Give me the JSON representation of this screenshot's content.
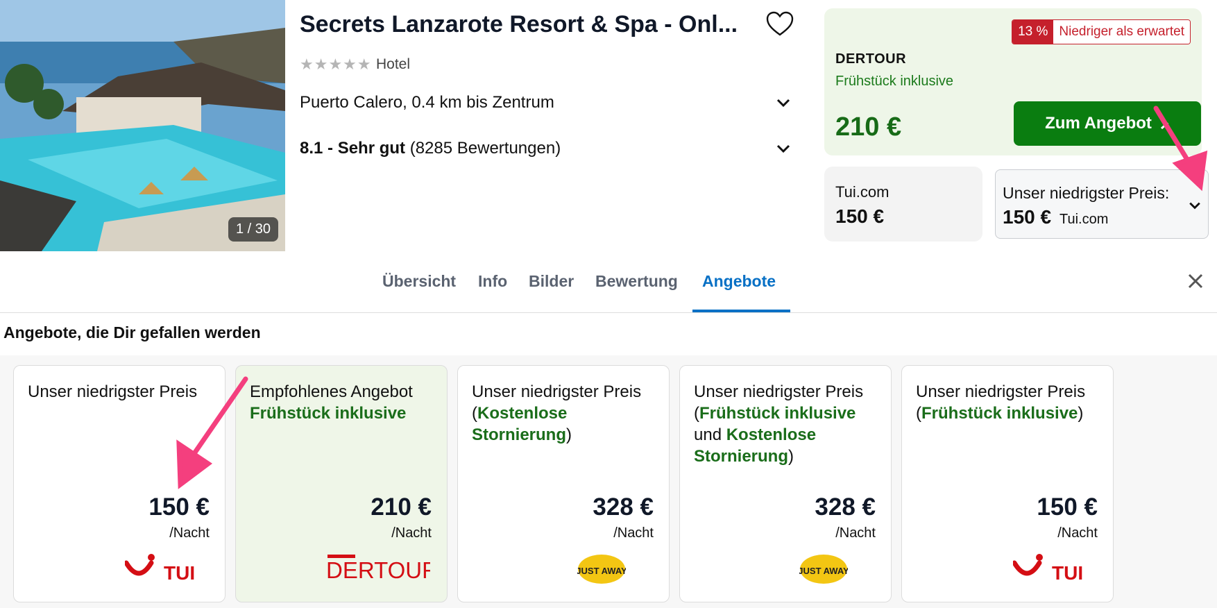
{
  "hotel": {
    "title": "Secrets Lanzarote Resort & Spa - Onl...",
    "stars": "★★★★★",
    "type": "Hotel",
    "location": "Puerto Calero, 0.4 km bis Zentrum",
    "rating_score": "8.1 - Sehr gut",
    "rating_count": "(8285 Bewertungen)",
    "image_counter": "1 / 30"
  },
  "offer": {
    "badge_pct": "13 %",
    "badge_text": "Niedriger als erwartet",
    "provider": "DERTOUR",
    "board": "Frühstück inklusive",
    "price": "210 €",
    "cta": "Zum Angebot"
  },
  "alt_offer": {
    "provider": "Tui.com",
    "price": "150 €"
  },
  "lowest": {
    "label": "Unser niedrigster Preis:",
    "price": "150 €",
    "provider": "Tui.com"
  },
  "tabs": [
    {
      "label": "Übersicht"
    },
    {
      "label": "Info"
    },
    {
      "label": "Bilder"
    },
    {
      "label": "Bewertung"
    },
    {
      "label": "Angebote"
    }
  ],
  "section_title": "Angebote, die Dir gefallen werden",
  "cards": [
    {
      "title": "Unser niedrigster Preis",
      "price": "150 €",
      "per": "/Nacht",
      "logo": "TUI"
    },
    {
      "title": "Empfohlenes Angebot",
      "extra": "Frühstück inklusive",
      "price": "210 €",
      "per": "/Nacht",
      "logo": "DERTOUR"
    },
    {
      "title": "Unser niedrigster Preis",
      "open": "(",
      "g1": "Kostenlose Stornierung",
      "close": ")",
      "price": "328 €",
      "per": "/Nacht",
      "logo": "JUST AWAY"
    },
    {
      "title": "Unser niedrigster Preis",
      "open": "(",
      "g1": "Frühstück inklusive",
      "mid": " und ",
      "g2": "Kostenlose Stornierung",
      "close": ")",
      "price": "328 €",
      "per": "/Nacht",
      "logo": "JUST AWAY"
    },
    {
      "title": "Unser niedrigster Preis",
      "open": "(",
      "g1": "Frühstück inklusive",
      "close": ")",
      "price": "150 €",
      "per": "/Nacht",
      "logo": "TUI"
    }
  ],
  "colors": {
    "accent": "#0770c5",
    "green": "#0a7d10",
    "red": "#c5202c",
    "tui": "#d40e14"
  }
}
